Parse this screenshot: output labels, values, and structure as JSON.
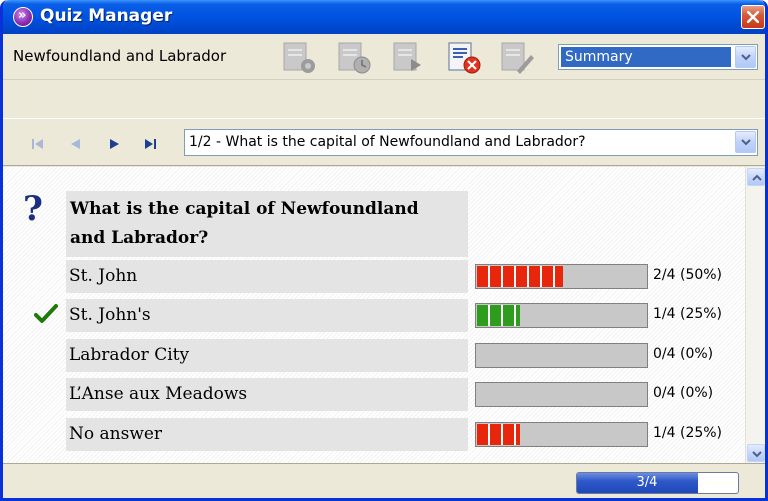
{
  "window": {
    "title": "Quiz Manager",
    "app_icon": "purple-chevron-icon"
  },
  "toolbar": {
    "quiz_name": "Newfoundland and Labrador",
    "tools": [
      "document-gear-icon",
      "document-clock-icon",
      "document-arrow-icon",
      "document-delete-icon",
      "document-pen-icon"
    ],
    "view_select": {
      "selected": "Summary"
    }
  },
  "navigation": {
    "buttons": [
      "first-icon",
      "previous-icon",
      "next-icon",
      "last-icon"
    ],
    "question_select": {
      "selected": "1/2 - What is the capital of Newfoundland and Labrador?"
    }
  },
  "question": {
    "text_line1": "What is the capital of Newfoundland",
    "text_line2": "and Labrador?",
    "answers": [
      {
        "label": "St. John",
        "stat": "2/4 (50%)",
        "fraction": 0.5,
        "correct": false
      },
      {
        "label": "St. John's",
        "stat": "1/4 (25%)",
        "fraction": 0.25,
        "correct": true
      },
      {
        "label": "Labrador City",
        "stat": "0/4 (0%)",
        "fraction": 0.0,
        "correct": false
      },
      {
        "label": "L’Anse aux Meadows",
        "stat": "0/4 (0%)",
        "fraction": 0.0,
        "correct": false
      },
      {
        "label": "No answer",
        "stat": "1/4 (25%)",
        "fraction": 0.25,
        "correct": false
      }
    ]
  },
  "status": {
    "progress_label": "3/4",
    "progress_fraction": 0.75
  },
  "colors": {
    "title_bar": "#0054e3",
    "wrong_bar": "#e8260c",
    "correct_bar": "#2e9c1c",
    "checkmark": "#1f7a0c",
    "progress": "#2f59c8"
  }
}
